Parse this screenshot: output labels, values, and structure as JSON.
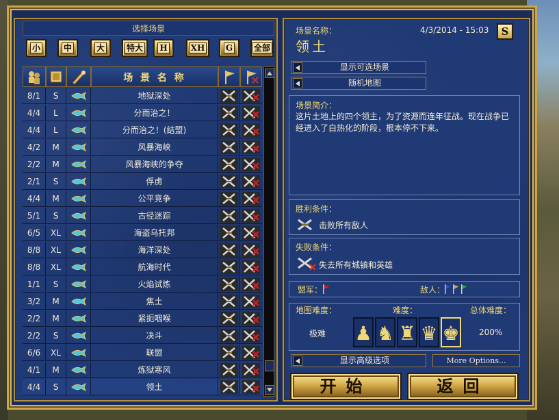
{
  "left": {
    "title": "选择场景",
    "size_filters": [
      "小",
      "中",
      "大",
      "特大",
      "H",
      "XH",
      "G",
      "全部"
    ],
    "header": {
      "name": "场 景 名 称"
    },
    "rows": [
      {
        "players": "8/1",
        "size": "S",
        "name": "地狱深处",
        "sel": false
      },
      {
        "players": "4/4",
        "size": "L",
        "name": "分而治之！",
        "sel": false
      },
      {
        "players": "4/4",
        "size": "L",
        "name": "分而治之！(结盟)",
        "sel": false
      },
      {
        "players": "4/2",
        "size": "M",
        "name": "风暴海峡",
        "sel": false
      },
      {
        "players": "2/2",
        "size": "M",
        "name": "风暴海峡的争夺",
        "sel": false
      },
      {
        "players": "2/1",
        "size": "S",
        "name": "俘虏",
        "sel": false
      },
      {
        "players": "4/4",
        "size": "M",
        "name": "公平竞争",
        "sel": false
      },
      {
        "players": "5/1",
        "size": "S",
        "name": "古径迷踪",
        "sel": false
      },
      {
        "players": "6/5",
        "size": "XL",
        "name": "海盗乌托邦",
        "sel": false
      },
      {
        "players": "8/8",
        "size": "XL",
        "name": "海洋深处",
        "sel": false
      },
      {
        "players": "8/8",
        "size": "XL",
        "name": "航海时代",
        "sel": false
      },
      {
        "players": "1/1",
        "size": "S",
        "name": "火焰试炼",
        "sel": false
      },
      {
        "players": "3/2",
        "size": "M",
        "name": "焦土",
        "sel": false
      },
      {
        "players": "2/2",
        "size": "M",
        "name": "紧扼咽喉",
        "sel": false
      },
      {
        "players": "2/2",
        "size": "S",
        "name": "决斗",
        "sel": false
      },
      {
        "players": "6/6",
        "size": "XL",
        "name": "联盟",
        "sel": false
      },
      {
        "players": "4/1",
        "size": "M",
        "name": "炼狱寒风",
        "sel": false
      },
      {
        "players": "4/4",
        "size": "S",
        "name": "领土",
        "sel": true
      }
    ]
  },
  "right": {
    "scenario_name_label": "场景名称：",
    "datetime": "4/3/2014 - 15:03",
    "size_badge": "S",
    "scenario_name": "领土",
    "btn_show_selectable": "显示可选场景",
    "btn_random_map": "随机地图",
    "intro_label": "场景简介：",
    "intro_text": "这片土地上的四个领主，为了资源而连年征战。现在战争已经进入了白热化的阶段，根本停不下来。",
    "victory_label": "胜利条件：",
    "victory_text": "击败所有敌人",
    "loss_label": "失败条件：",
    "loss_text": "失去所有城镇和英雄",
    "allies_label": "盟军：",
    "enemies_label": "敌人：",
    "map_difficulty_label": "地图难度：",
    "difficulty_label": "难度：",
    "overall_difficulty_label": "总体难度：",
    "map_difficulty_value": "极难",
    "overall_difficulty_value": "200%",
    "btn_advanced": "显示高级选项",
    "btn_more_options": "More Options...",
    "btn_start": "开始",
    "btn_back": "返回"
  },
  "colors": {
    "panel_blue": "#203a75",
    "gold": "#f2d873",
    "frame_gold": "#c9a64a"
  }
}
